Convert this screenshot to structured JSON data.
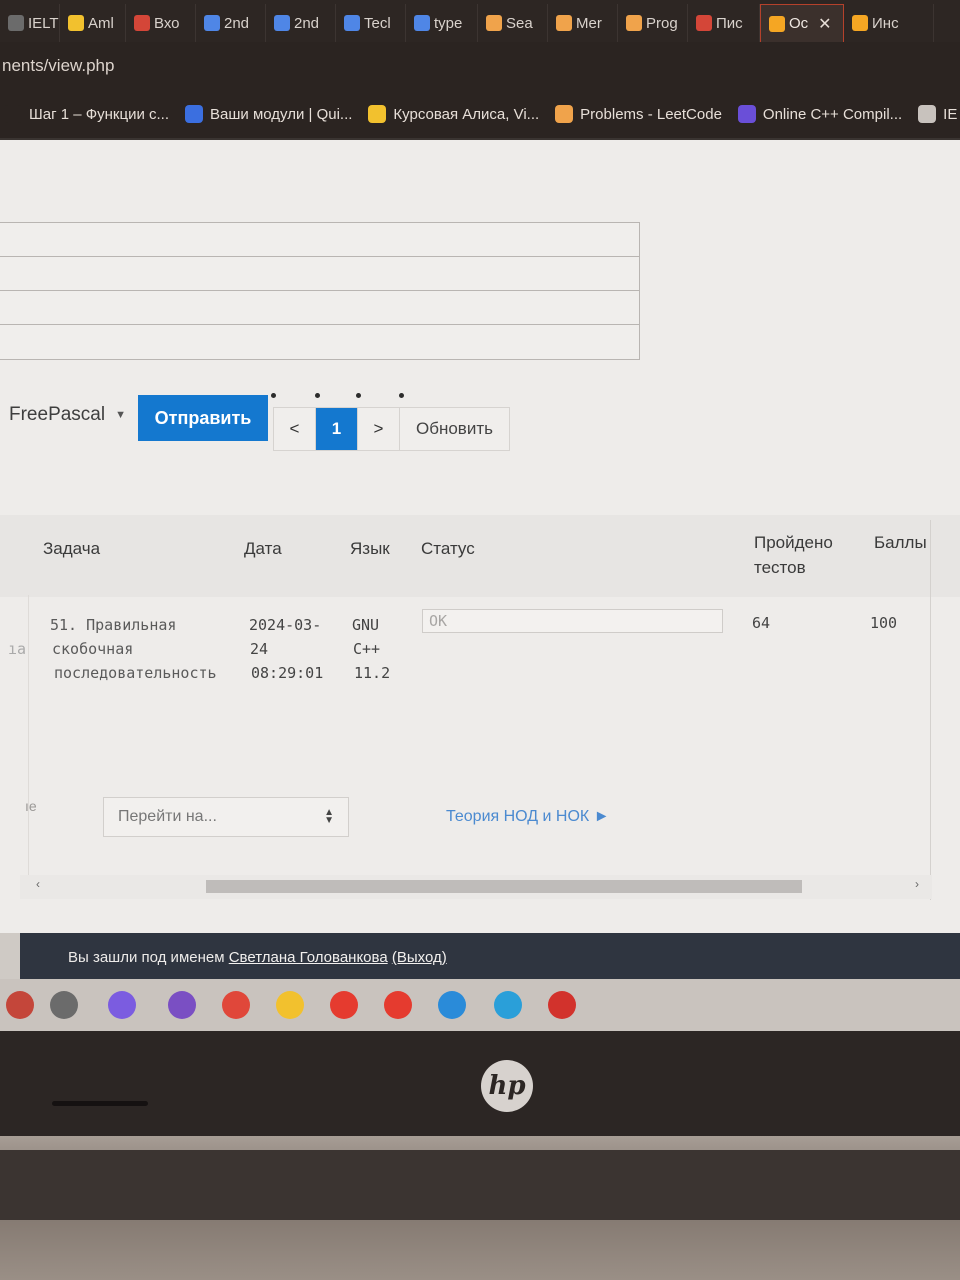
{
  "browser": {
    "tabs": [
      {
        "label": "IELT",
        "color": "#6b6b6b"
      },
      {
        "label": "Aml",
        "color": "#f2c12e"
      },
      {
        "label": "Вхо",
        "color": "#d44638"
      },
      {
        "label": "2nd",
        "color": "#4f86e6"
      },
      {
        "label": "2nd",
        "color": "#4f86e6"
      },
      {
        "label": "Tecl",
        "color": "#4f86e6"
      },
      {
        "label": "type",
        "color": "#4f86e6"
      },
      {
        "label": "Sea",
        "color": "#f0a34b"
      },
      {
        "label": "Mer",
        "color": "#f0a34b"
      },
      {
        "label": "Prog",
        "color": "#f0a34b"
      },
      {
        "label": "Пис",
        "color": "#d44638"
      },
      {
        "label": "Ос",
        "color": "#f5a623",
        "active": true
      },
      {
        "label": "Инс",
        "color": "#f5a623"
      }
    ],
    "address": "nents/view.php",
    "bookmarks": [
      {
        "label": "Шаг 1 – Функции с...",
        "color": "#2b2421"
      },
      {
        "label": "Ваши модули | Qui...",
        "color": "#3b6fe0"
      },
      {
        "label": "Курсовая Алиса, Vi...",
        "color": "#f2c12e"
      },
      {
        "label": "Problems - LeetCode",
        "color": "#f0a34b"
      },
      {
        "label": "Online C++ Compil...",
        "color": "#6a4fd8"
      },
      {
        "label": "IE",
        "color": "#c8c2bd"
      }
    ]
  },
  "toolbar": {
    "language": "FreePascal",
    "send_label": "Отправить",
    "pager_prev": "<",
    "pager_current": "1",
    "pager_next": ">",
    "refresh_label": "Обновить"
  },
  "table": {
    "headers": {
      "task": "Задача",
      "date": "Дата",
      "lang": "Язык",
      "status": "Статус",
      "passed_1": "Пройдено",
      "passed_2": "тестов",
      "score": "Баллы"
    },
    "row": {
      "task_1": "51. Правильная",
      "task_2": "скобочная",
      "task_3": "последовательность",
      "date_1": "2024-03-",
      "date_2": "24",
      "date_3": "08:29:01",
      "lang_1": "GNU",
      "lang_2": "C++",
      "lang_3": "11.2",
      "status": "OK",
      "passed": "64",
      "score": "100"
    },
    "left_fragment": "ıa",
    "left_fragment_2": "ıe"
  },
  "nav": {
    "jump_placeholder": "Перейти на...",
    "next_link": "Теория НОД и НОК ►"
  },
  "footer": {
    "prefix": "Вы зашли под именем",
    "user": "Светлана Голованкова",
    "logout": "(Выход)"
  },
  "taskbar": {
    "icons": [
      {
        "name": "start",
        "color": "#c4463a"
      },
      {
        "name": "task-view",
        "color": "#6b6b6b"
      },
      {
        "name": "cortana",
        "color": "#7b5ce0"
      },
      {
        "name": "visual-studio",
        "color": "#7a4fc3"
      },
      {
        "name": "chrome",
        "color": "#e0473a"
      },
      {
        "name": "file-explorer",
        "color": "#f2c12e"
      },
      {
        "name": "yandex",
        "color": "#e53b2f"
      },
      {
        "name": "yandex-browser",
        "color": "#e53b2f"
      },
      {
        "name": "edge",
        "color": "#2a8bd9"
      },
      {
        "name": "telegram",
        "color": "#2a9fd9"
      },
      {
        "name": "opera",
        "color": "#d2322c"
      }
    ]
  },
  "laptop": {
    "logo": "hp"
  }
}
